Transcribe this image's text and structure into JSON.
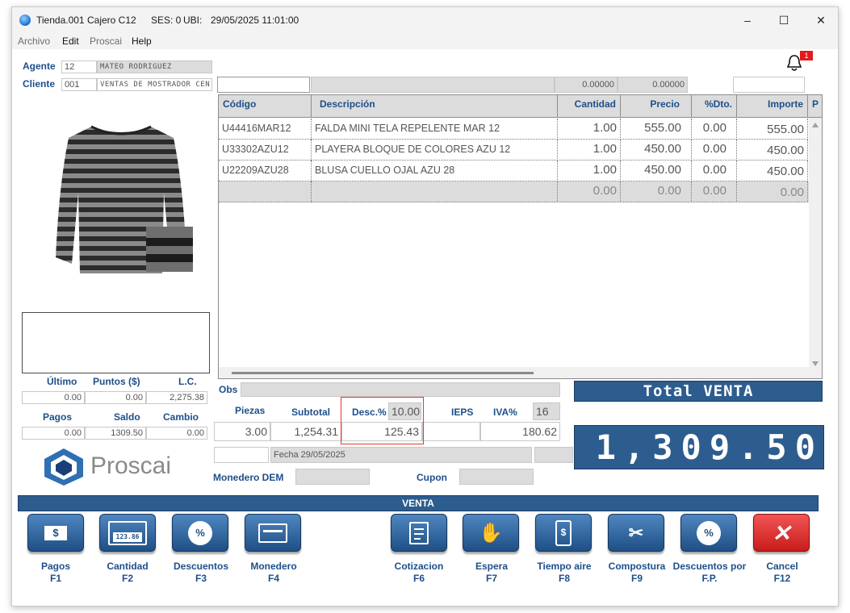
{
  "titlebar": {
    "store": "Tienda.001",
    "cashier": "Cajero C12",
    "session": "SES: 0",
    "ubi": "UBI:",
    "datetime": "29/05/2025 11:01:00",
    "minimize": "–",
    "maximize": "☐",
    "close": "✕"
  },
  "menu": [
    "Archivo",
    "Edit",
    "Proscai",
    "Help"
  ],
  "notification_count": "1",
  "agent": {
    "label": "Agente",
    "code": "12",
    "name": "MATEO RODRIGUEZ"
  },
  "client": {
    "label": "Cliente",
    "code": "001",
    "name": "VENTAS DE MOSTRADOR CEN"
  },
  "entry_row": {
    "cantidad": "0.00000",
    "precio": "0.00000"
  },
  "grid": {
    "headers": [
      "Código",
      "Descripción",
      "Cantidad",
      "Precio",
      "%Dto.",
      "Importe",
      "P"
    ],
    "rows": [
      {
        "codigo": "U44416MAR12",
        "descripcion": "FALDA MINI TELA REPELENTE MAR 12",
        "cantidad": "1.00",
        "precio": "555.00",
        "dto": "0.00",
        "importe": "555.00"
      },
      {
        "codigo": "U33302AZU12",
        "descripcion": "PLAYERA BLOQUE DE COLORES AZU 12",
        "cantidad": "1.00",
        "precio": "450.00",
        "dto": "0.00",
        "importe": "450.00"
      },
      {
        "codigo": "U22209AZU28",
        "descripcion": "BLUSA CUELLO OJAL AZU 28",
        "cantidad": "1.00",
        "precio": "450.00",
        "dto": "0.00",
        "importe": "450.00"
      },
      {
        "codigo": "",
        "descripcion": "",
        "cantidad": "0.00",
        "precio": "0.00",
        "dto": "0.00",
        "importe": "0.00"
      }
    ]
  },
  "left_stats": {
    "ultimo_label": "Último",
    "puntos_label": "Puntos ($)",
    "lc_label": "L.C.",
    "ultimo": "0.00",
    "puntos": "0.00",
    "lc": "2,275.38",
    "pagos_label": "Pagos",
    "saldo_label": "Saldo",
    "cambio_label": "Cambio",
    "pagos": "0.00",
    "saldo": "1309.50",
    "cambio": "0.00"
  },
  "logo": {
    "text": "Proscai"
  },
  "summary": {
    "obs_label": "Obs",
    "piezas_label": "Piezas",
    "subtotal_label": "Subtotal",
    "desc_label": "Desc.%",
    "desc_pct": "10.00",
    "ieps_label": "IEPS",
    "iva_label": "IVA%",
    "iva_pct": "16",
    "piezas": "3.00",
    "subtotal": "1,254.31",
    "descuento": "125.43",
    "ieps": "",
    "iva": "180.62",
    "fecha": "Fecha 29/05/2025",
    "monedero_label": "Monedero DEM",
    "cupon_label": "Cupon"
  },
  "total": {
    "label": "Total VENTA",
    "value": "1,309.50"
  },
  "mode_bar": "VENTA",
  "function_keys": [
    {
      "name": "Pagos",
      "key": "F1"
    },
    {
      "name": "Cantidad",
      "key": "F2"
    },
    {
      "name": "Descuentos",
      "key": "F3"
    },
    {
      "name": "Monedero",
      "key": "F4"
    },
    {
      "name": "Cotizacion",
      "key": "F6"
    },
    {
      "name": "Espera",
      "key": "F7"
    },
    {
      "name": "Tiempo aire",
      "key": "F8"
    },
    {
      "name": "Compostura",
      "key": "F9"
    },
    {
      "name": "Descuentos por",
      "key": "F.P."
    },
    {
      "name": "Cancel",
      "key": "F12"
    }
  ],
  "icons": {
    "pagos": "money-icon",
    "cantidad": "calculator-icon",
    "descuentos": "percent-badge-icon",
    "monedero": "wallet-card-icon",
    "cotizacion": "edit-note-icon",
    "espera": "hand-icon",
    "tiempo_aire": "phone-dollar-icon",
    "compostura": "scissors-icon",
    "descuentos_fp": "percent-badge-icon",
    "cancel": "x-icon",
    "bell": "bell-icon"
  },
  "colors": {
    "accent": "#2d5d8f",
    "label": "#1d4f8a",
    "cancel": "#d92424"
  },
  "calc_display": "123.86"
}
